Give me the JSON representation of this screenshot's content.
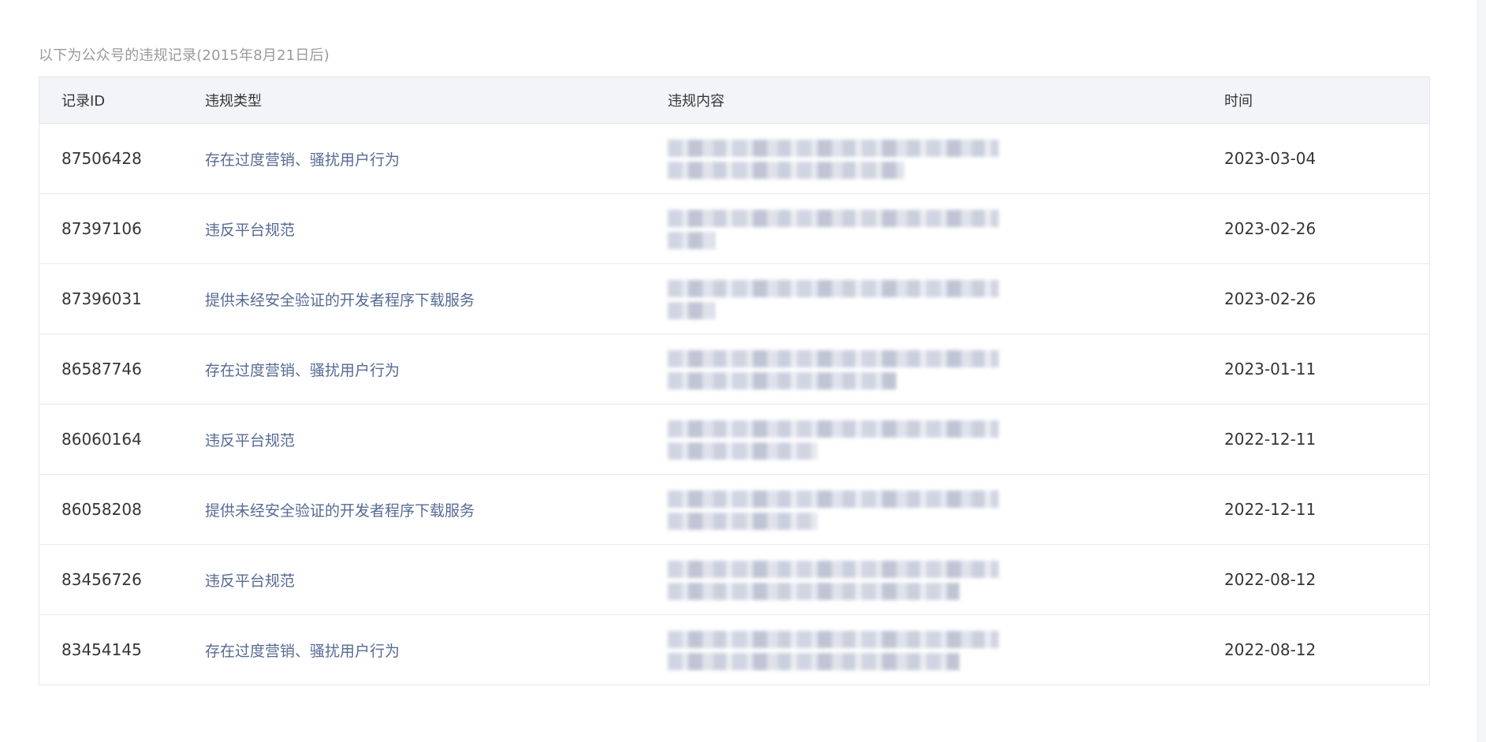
{
  "caption": "以下为公众号的违规记录(2015年8月21日后)",
  "columns": {
    "id": "记录ID",
    "type": "违规类型",
    "content": "违规内容",
    "time": "时间"
  },
  "rows": [
    {
      "id": "87506428",
      "type": "存在过度营销、骚扰用户行为",
      "time": "2023-03-04"
    },
    {
      "id": "87397106",
      "type": "违反平台规范",
      "time": "2023-02-26"
    },
    {
      "id": "87396031",
      "type": "提供未经安全验证的开发者程序下载服务",
      "time": "2023-02-26"
    },
    {
      "id": "86587746",
      "type": "存在过度营销、骚扰用户行为",
      "time": "2023-01-11"
    },
    {
      "id": "86060164",
      "type": "违反平台规范",
      "time": "2022-12-11"
    },
    {
      "id": "86058208",
      "type": "提供未经安全验证的开发者程序下载服务",
      "time": "2022-12-11"
    },
    {
      "id": "83456726",
      "type": "违反平台规范",
      "time": "2022-08-12"
    },
    {
      "id": "83454145",
      "type": "存在过度营销、骚扰用户行为",
      "time": "2022-08-12"
    }
  ]
}
